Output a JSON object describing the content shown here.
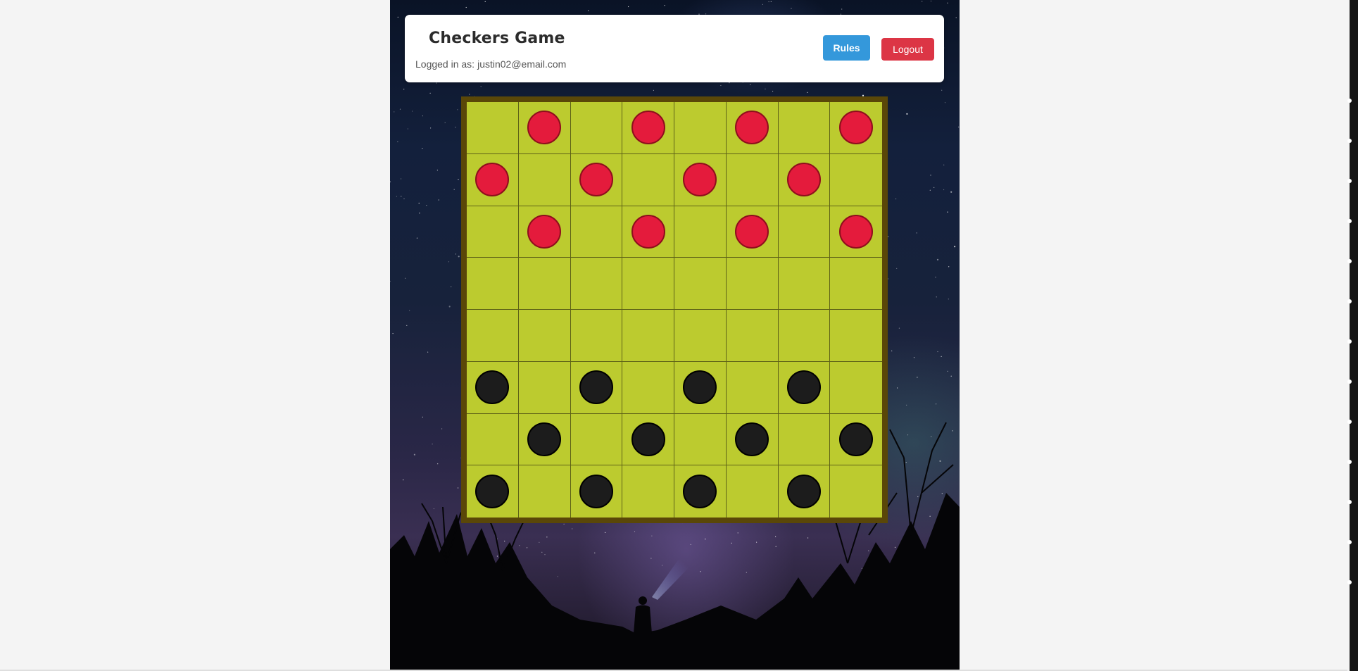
{
  "header": {
    "title": "Checkers Game",
    "logged_in_label": "Logged in as:",
    "user_email": "justin02@email.com",
    "rules_button": "Rules",
    "logout_button": "Logout"
  },
  "board": {
    "size": 8,
    "rows": [
      [
        "",
        "red",
        "",
        "red",
        "",
        "red",
        "",
        "red"
      ],
      [
        "red",
        "",
        "red",
        "",
        "red",
        "",
        "red",
        ""
      ],
      [
        "",
        "red",
        "",
        "red",
        "",
        "red",
        "",
        "red"
      ],
      [
        "",
        "",
        "",
        "",
        "",
        "",
        "",
        ""
      ],
      [
        "",
        "",
        "",
        "",
        "",
        "",
        "",
        ""
      ],
      [
        "black",
        "",
        "black",
        "",
        "black",
        "",
        "black",
        ""
      ],
      [
        "",
        "black",
        "",
        "black",
        "",
        "black",
        "",
        "black"
      ],
      [
        "black",
        "",
        "black",
        "",
        "black",
        "",
        "black",
        ""
      ]
    ]
  },
  "colors": {
    "board_square": "#bccb2f",
    "board_frame": "#5a4708",
    "red_piece": "#e41b3c",
    "black_piece": "#1c1c1c",
    "rules_button": "#3498db",
    "logout_button": "#dc3545"
  }
}
